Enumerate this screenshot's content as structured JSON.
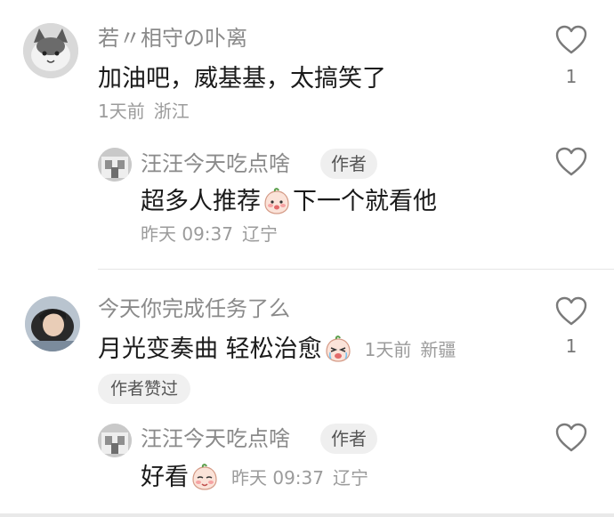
{
  "comments": [
    {
      "user": "若〃相守の卟离",
      "text": "加油吧，威基基，太搞笑了",
      "time": "1天前",
      "location": "浙江",
      "likes": "1",
      "reply": {
        "user": "汪汪今天吃点啥",
        "badge": "作者",
        "text_before": "超多人推荐",
        "text_after": "下一个就看他",
        "time": "昨天 09:37",
        "location": "辽宁"
      }
    },
    {
      "user": "今天你完成任务了么",
      "text": "月光变奏曲 轻松治愈",
      "time": "1天前",
      "location": "新疆",
      "likes": "1",
      "liked_badge": "作者赞过",
      "reply": {
        "user": "汪汪今天吃点啥",
        "badge": "作者",
        "text": "好看",
        "time": "昨天 09:37",
        "location": "辽宁"
      }
    }
  ],
  "icons": {
    "like": "heart-outline-icon",
    "emoji_1": "blushing-peach-emoji",
    "emoji_2": "crying-peach-emoji",
    "emoji_3": "shy-peach-emoji"
  },
  "colors": {
    "name": "#8a8a8a",
    "text": "#1a1a1a",
    "meta": "#9b9b9b",
    "badge_bg": "#efefef"
  }
}
